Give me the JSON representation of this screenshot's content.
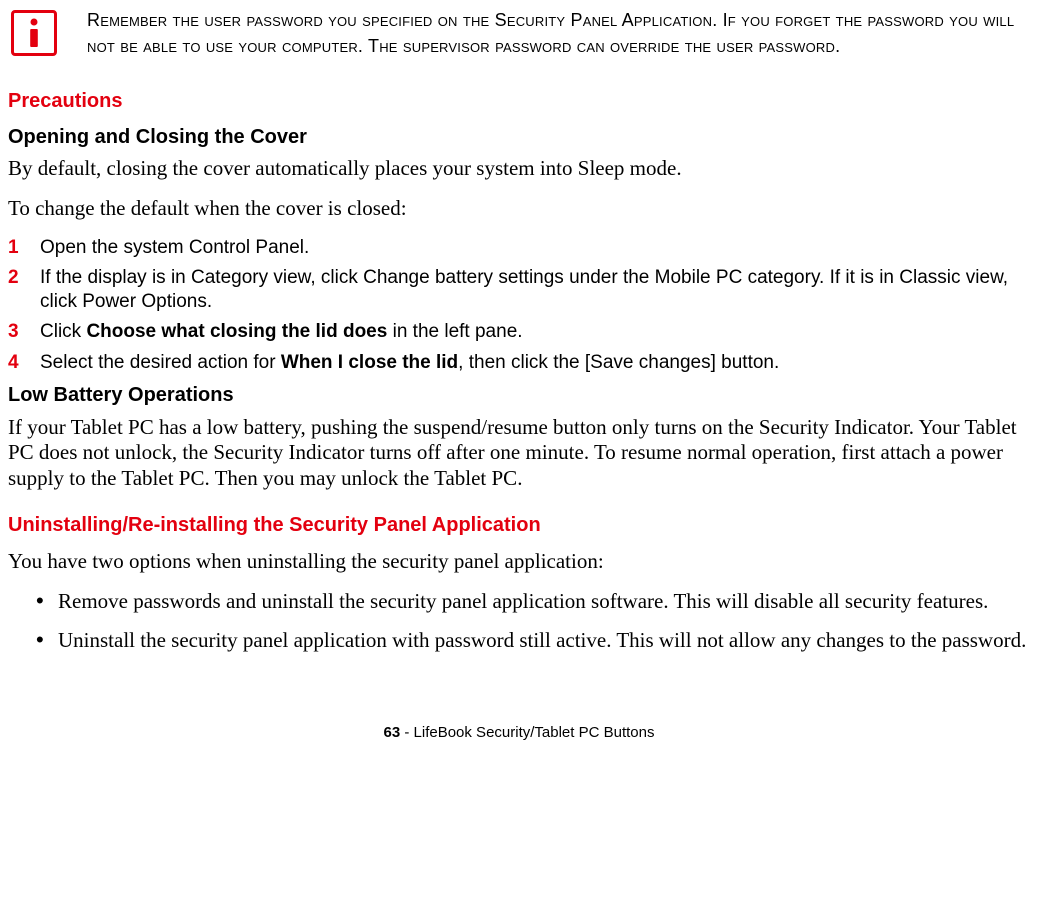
{
  "note": {
    "text": "Remember the user password you specified on the Security Panel Application. If you forget the password you will not be able to use your computer. The supervisor password can override the user password."
  },
  "section_precautions": {
    "title": "Precautions",
    "sub_open_close": "Opening and Closing the Cover",
    "p1": "By default, closing the cover automatically places your system into Sleep mode.",
    "p2": "To change the default when the cover is closed:",
    "steps": [
      {
        "n": "1",
        "t": "Open the system Control Panel."
      },
      {
        "n": "2",
        "t": "If the display is in Category view, click Change battery settings under the Mobile PC category. If it is in Classic view, click Power Options."
      },
      {
        "n": "3",
        "t_pre": "Click ",
        "t_bold": "Choose what closing the lid does",
        "t_post": " in the left pane."
      },
      {
        "n": "4",
        "t_pre": "Select the desired action for ",
        "t_bold": "When I close the lid",
        "t_post": ", then click the [Save changes] button."
      }
    ],
    "sub_low_batt": "Low Battery Operations",
    "p_low": "If your Tablet PC has a low battery, pushing the suspend/resume button only turns on the Security Indicator. Your Tablet PC does not unlock, the Security Indicator turns off after one minute. To resume normal operation, first attach a power supply to the Tablet PC. Then you may unlock the Tablet PC."
  },
  "section_uninstall": {
    "title": "Uninstalling/Re-installing the Security Panel Application",
    "p1": "You have two options when uninstalling the security panel application:",
    "bullets": [
      "Remove passwords and uninstall the security panel application software. This will disable all security features.",
      "Uninstall the security panel application with password still active. This will not allow any changes to the password."
    ]
  },
  "footer": {
    "page": "63",
    "suffix": " - LifeBook Security/Tablet PC Buttons"
  }
}
